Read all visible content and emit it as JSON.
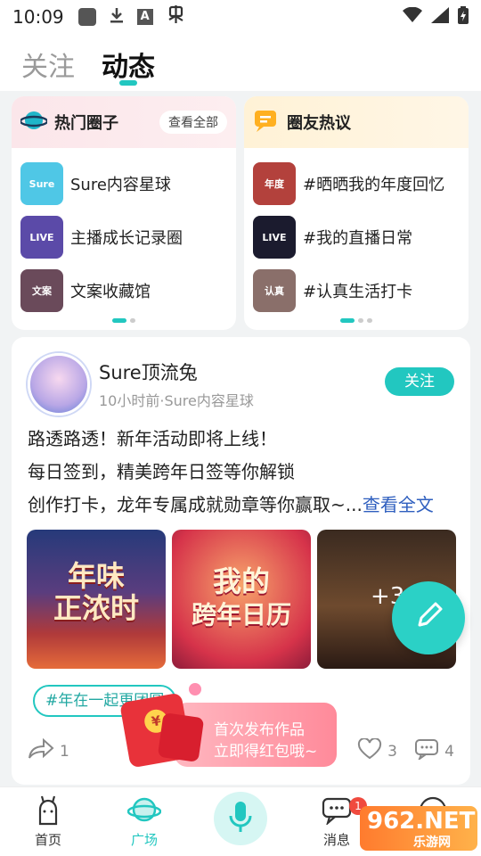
{
  "status_bar": {
    "time": "10:09"
  },
  "header": {
    "tabs": [
      {
        "label": "关注"
      },
      {
        "label": "动态"
      }
    ]
  },
  "hot_circles": {
    "title": "热门圈子",
    "see_all": "查看全部",
    "items": [
      {
        "label": "Sure内容星球",
        "thumb": "Sure",
        "color": "#4fc7e6"
      },
      {
        "label": "主播成长记录圈",
        "thumb": "LIVE",
        "color": "#5b4aa8"
      },
      {
        "label": "文案收藏馆",
        "thumb": "文案",
        "color": "#6a4a5a"
      }
    ]
  },
  "hot_topics": {
    "title": "圈友热议",
    "items": [
      {
        "label": "#晒晒我的年度回忆",
        "thumb": "年度",
        "color": "#b3413c"
      },
      {
        "label": "#我的直播日常",
        "thumb": "LIVE",
        "color": "#1b1b2e"
      },
      {
        "label": "#认真生活打卡",
        "thumb": "认真",
        "color": "#8a6f6a"
      }
    ]
  },
  "post": {
    "author": "Sure顶流兔",
    "meta": "10小时前·Sure内容星球",
    "follow": "关注",
    "lines": [
      "路透路透！新年活动即将上线！",
      "每日签到，精美跨年日签等你解锁",
      "创作打卡，龙年专属成就勋章等你赢取~..."
    ],
    "read_more": "查看全文",
    "images": [
      {
        "caption1": "年味",
        "caption2": "正浓时"
      },
      {
        "caption1": "我的",
        "caption2": "跨年日历"
      },
      {
        "more": "+3"
      }
    ],
    "tag": "#年在一起更团圆",
    "shares": "1",
    "likes": "3",
    "comments": "4"
  },
  "red_packet": {
    "line1": "首次发布作品",
    "line2": "立即得红包哦~",
    "coin": "¥"
  },
  "bottom_nav": {
    "home": "首页",
    "square": "广场",
    "messages": "消息",
    "message_badge": "1"
  },
  "watermark": {
    "top": "962.NET",
    "bottom": "乐游网"
  },
  "colors": {
    "accent": "#22c7c0",
    "link": "#2f5fbf",
    "badge": "#f04a3e"
  }
}
